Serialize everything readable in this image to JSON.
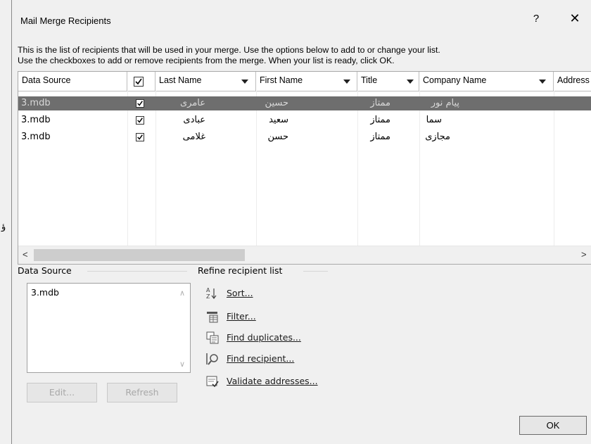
{
  "window": {
    "title": "Mail Merge Recipients",
    "help_label": "?",
    "close_label": "✕",
    "side_mark": "ؤ"
  },
  "instructions": {
    "line1": "This is the list of recipients that will be used in your merge.  Use the options below to add to or change your list.",
    "line2": "Use the checkboxes to add or remove recipients from the merge.  When your list is ready, click OK."
  },
  "grid": {
    "columns": {
      "data_source": "Data Source",
      "last_name": "Last Name",
      "first_name": "First Name",
      "title": "Title",
      "company": "Company Name",
      "address": "Address"
    },
    "header_checked": true,
    "rows": [
      {
        "source": "3.mdb",
        "checked": true,
        "last": "عامری",
        "first": "حسین",
        "title": "ممتاز",
        "company": "پیام نور",
        "selected": true
      },
      {
        "source": "3.mdb",
        "checked": true,
        "last": "عبادی",
        "first": "سعید",
        "title": "ممتاز",
        "company": "سما",
        "selected": false
      },
      {
        "source": "3.mdb",
        "checked": true,
        "last": "غلامی",
        "first": "حسن",
        "title": "ممتاز",
        "company": "مجازی",
        "selected": false
      }
    ],
    "scroll_left": "<",
    "scroll_right": ">"
  },
  "data_source_group": {
    "label": "Data Source",
    "items": [
      "3.mdb"
    ],
    "edit_label": "Edit...",
    "refresh_label": "Refresh"
  },
  "refine_group": {
    "label": "Refine recipient list",
    "links": [
      {
        "label": "Sort...",
        "icon": "sort-az-icon"
      },
      {
        "label": "Filter...",
        "icon": "filter-icon"
      },
      {
        "label": "Find duplicates...",
        "icon": "find-duplicates-icon"
      },
      {
        "label": "Find recipient...",
        "icon": "find-recipient-icon"
      },
      {
        "label": "Validate addresses...",
        "icon": "validate-addresses-icon"
      }
    ]
  },
  "footer": {
    "ok_label": "OK"
  }
}
